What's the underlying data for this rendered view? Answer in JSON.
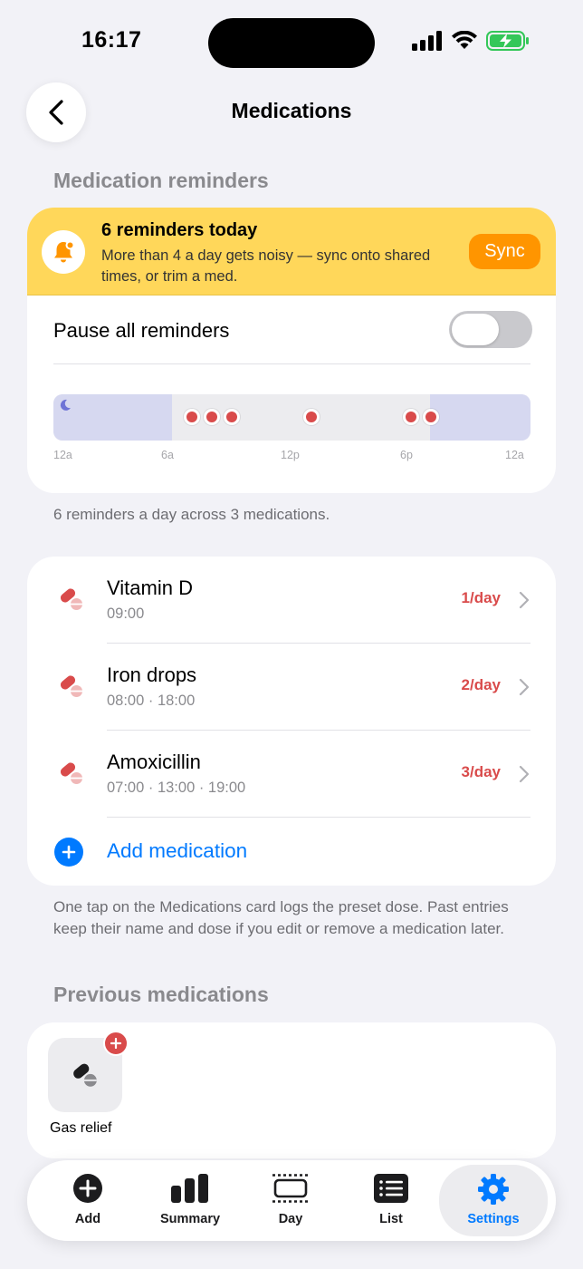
{
  "status_bar": {
    "time": "16:17"
  },
  "nav": {
    "title": "Medications"
  },
  "reminders": {
    "section_title": "Medication reminders",
    "banner_title": "6 reminders today",
    "banner_subtitle": "More than 4 a day gets noisy — sync onto shared times, or trim a med.",
    "sync_label": "Sync",
    "pause_label": "Pause all reminders",
    "pause_on": false,
    "timeline_ticks": [
      "12a",
      "6a",
      "12p",
      "6p",
      "12a"
    ],
    "summary": "6 reminders a day across 3 medications."
  },
  "medications": [
    {
      "name": "Vitamin D",
      "times": "09:00",
      "frequency": "1/day"
    },
    {
      "name": "Iron drops",
      "times": "08:00 · 18:00",
      "frequency": "2/day"
    },
    {
      "name": "Amoxicillin",
      "times": "07:00 · 13:00 · 19:00",
      "frequency": "3/day"
    }
  ],
  "add_medication_label": "Add medication",
  "medications_note": "One tap on the Medications card logs the preset dose. Past entries keep their name and dose if you edit or remove a medication later.",
  "previous": {
    "section_title": "Previous medications",
    "items": [
      {
        "name": "Gas relief"
      }
    ]
  },
  "tabs": [
    {
      "label": "Add",
      "icon": "add-icon"
    },
    {
      "label": "Summary",
      "icon": "bar-chart-icon"
    },
    {
      "label": "Day",
      "icon": "day-icon"
    },
    {
      "label": "List",
      "icon": "list-icon"
    },
    {
      "label": "Settings",
      "icon": "gear-icon",
      "active": true
    }
  ],
  "colors": {
    "accent": "#007aff",
    "warning_banner": "#ffd75a",
    "sync_button": "#ff9500",
    "dose_red": "#d94b4b"
  }
}
